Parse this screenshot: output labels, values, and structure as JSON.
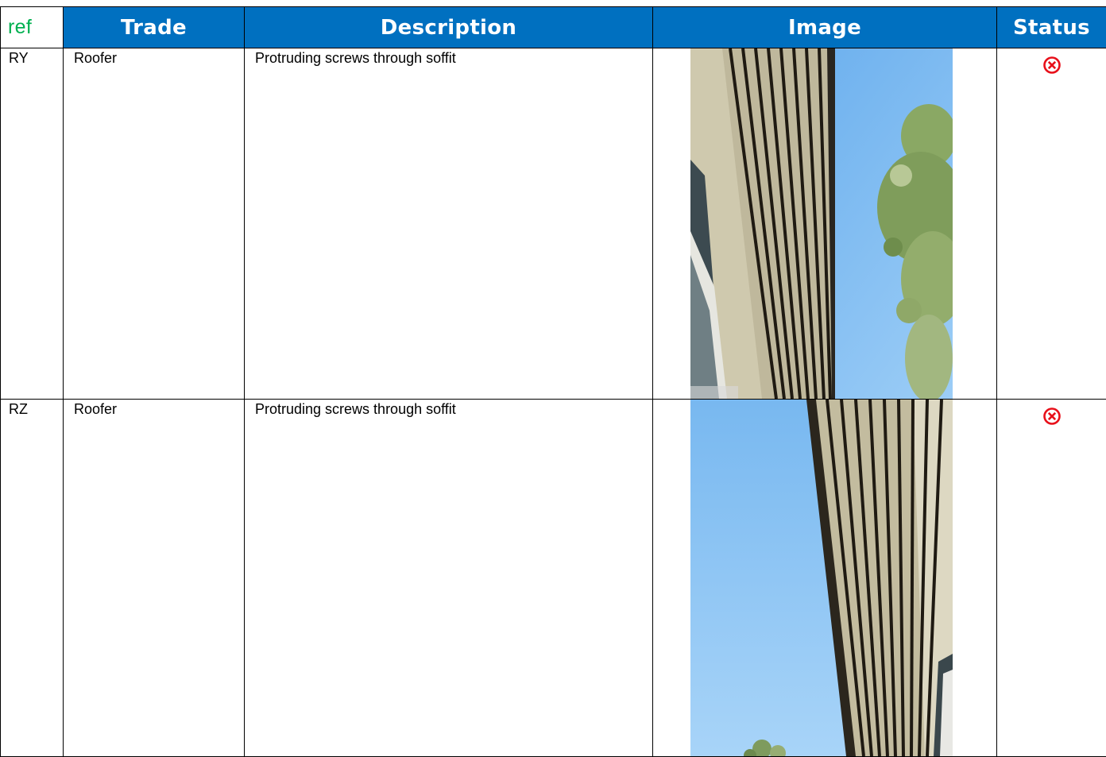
{
  "table": {
    "headers": {
      "ref": "ref",
      "trade": "Trade",
      "description": "Description",
      "image": "Image",
      "status": "Status"
    },
    "rows": [
      {
        "ref": "RY",
        "trade": "Roofer",
        "description": "Protruding screws through soffit",
        "image_icon": "soffit-photo",
        "status_icon": "cross-circle-icon"
      },
      {
        "ref": "RZ",
        "trade": "Roofer",
        "description": "Protruding screws through soffit",
        "image_icon": "soffit-photo",
        "status_icon": "cross-circle-icon"
      }
    ]
  },
  "colors": {
    "header_bg": "#0070c0",
    "header_text": "#ffffff",
    "ref_header_text": "#00b050",
    "status_red": "#e8101a"
  }
}
